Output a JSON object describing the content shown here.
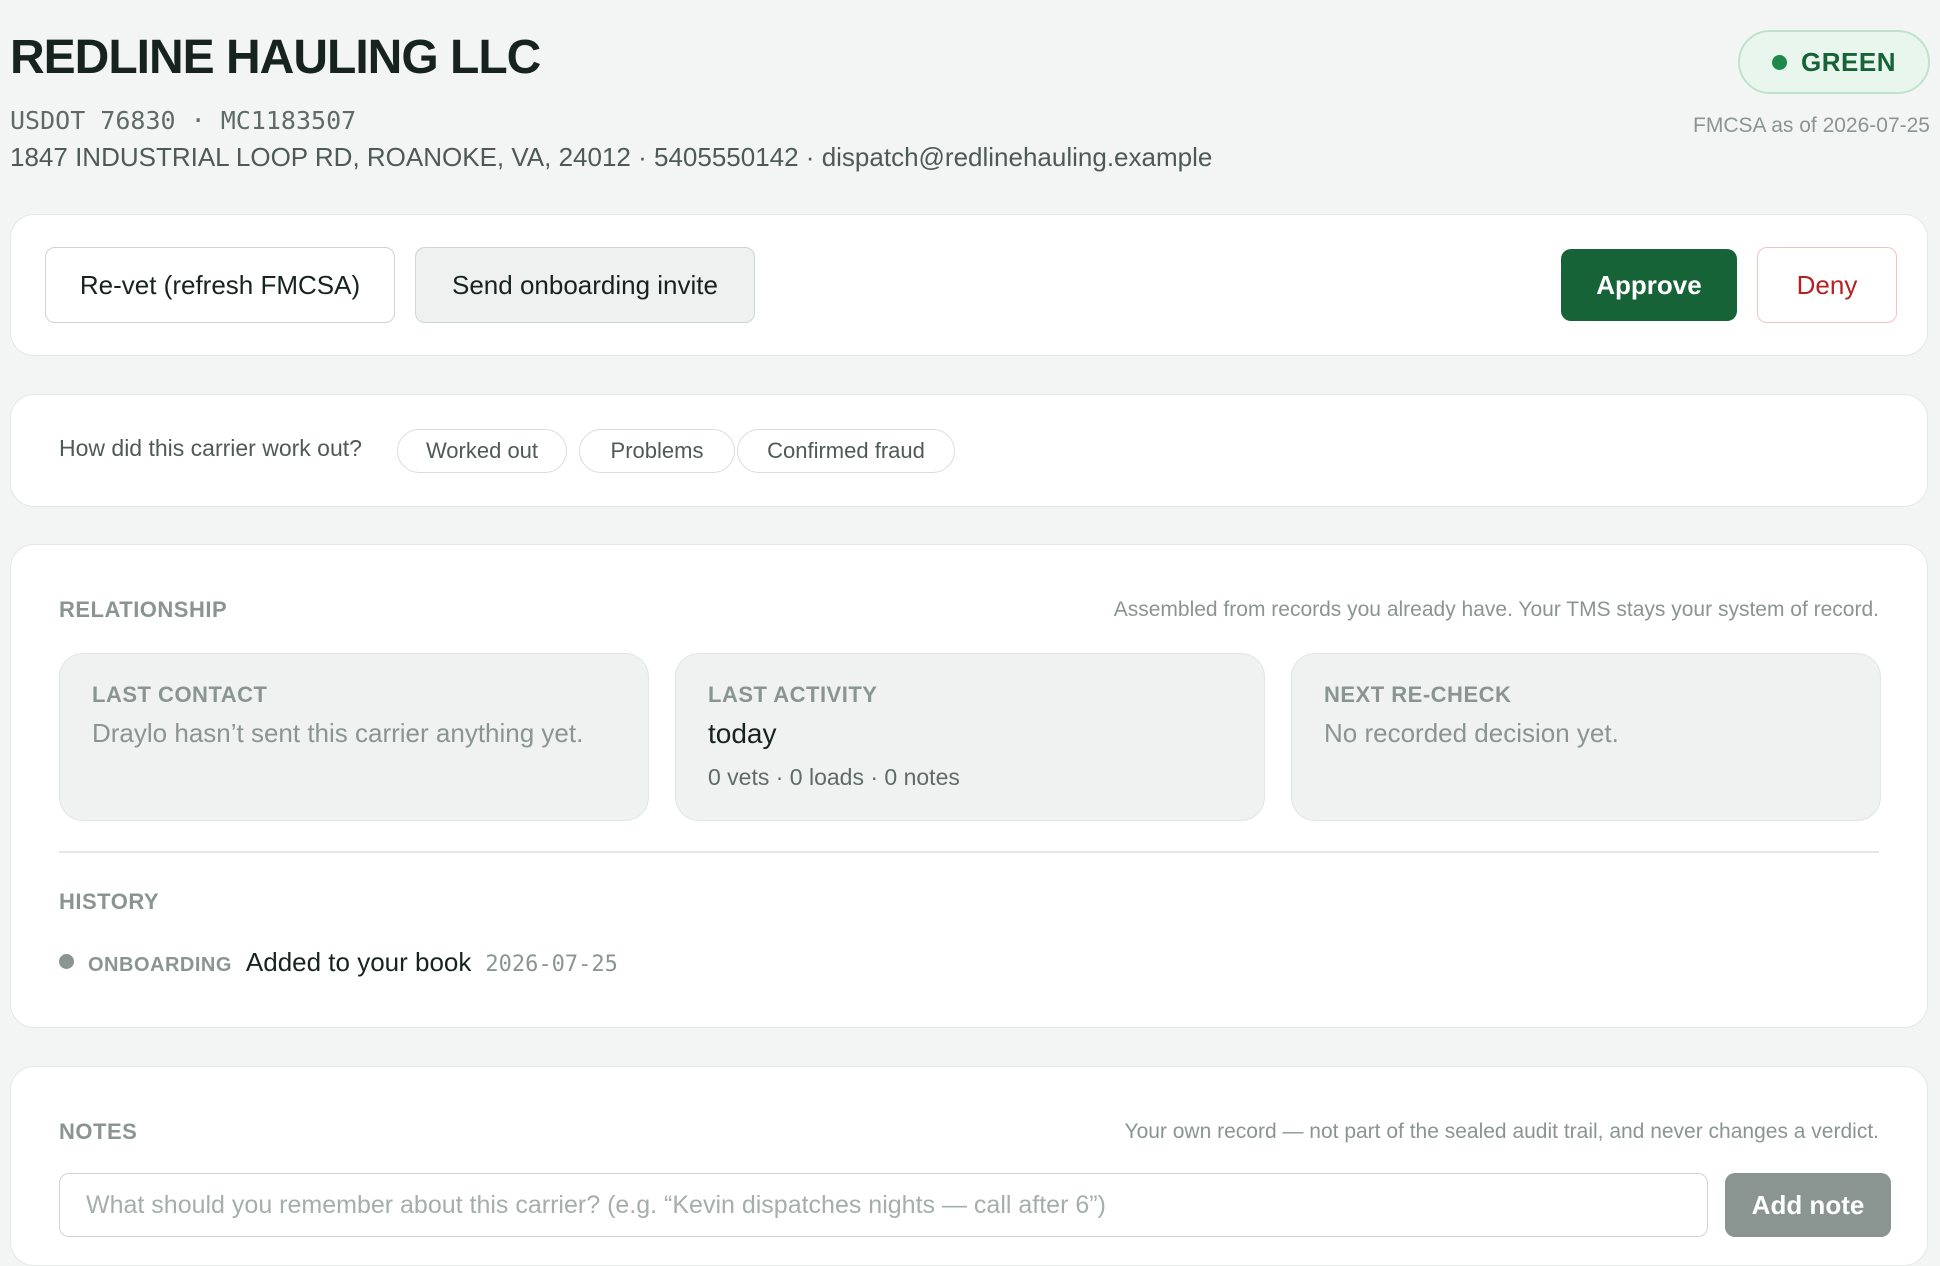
{
  "carrier": {
    "name": "REDLINE HAULING LLC",
    "ids": "USDOT 76830 · MC1183507",
    "contact_line": "1847 INDUSTRIAL LOOP RD, ROANOKE, VA, 24012 · 5405550142 · dispatch@redlinehauling.example",
    "status": "GREEN",
    "status_color": "#1d8a4a",
    "fmcsa_asof": "FMCSA as of 2026-07-25"
  },
  "actions": {
    "revet_label": "Re-vet (refresh FMCSA)",
    "invite_label": "Send onboarding invite",
    "approve_label": "Approve",
    "deny_label": "Deny",
    "approve_color": "#166338",
    "deny_color": "#b42121"
  },
  "feedback": {
    "question": "How did this carrier work out?",
    "options": [
      "Worked out",
      "Problems",
      "Confirmed fraud"
    ]
  },
  "relationship": {
    "label": "RELATIONSHIP",
    "note": "Assembled from records you already have. Your TMS stays your system of record.",
    "tiles": [
      {
        "title": "LAST CONTACT",
        "text": "Draylo hasn’t sent this carrier anything yet."
      },
      {
        "title": "LAST ACTIVITY",
        "value": "today",
        "sub": "0 vets · 0 loads · 0 notes"
      },
      {
        "title": "NEXT RE-CHECK",
        "text": "No recorded decision yet."
      }
    ]
  },
  "history": {
    "label": "HISTORY",
    "items": [
      {
        "type": "ONBOARDING",
        "text": "Added to your book",
        "date": "2026-07-25"
      }
    ]
  },
  "notes": {
    "label": "NOTES",
    "note": "Your own record — not part of the sealed audit trail, and never changes a verdict.",
    "placeholder": "What should you remember about this carrier? (e.g. “Kevin dispatches nights — call after 6”)",
    "add_label": "Add note"
  }
}
